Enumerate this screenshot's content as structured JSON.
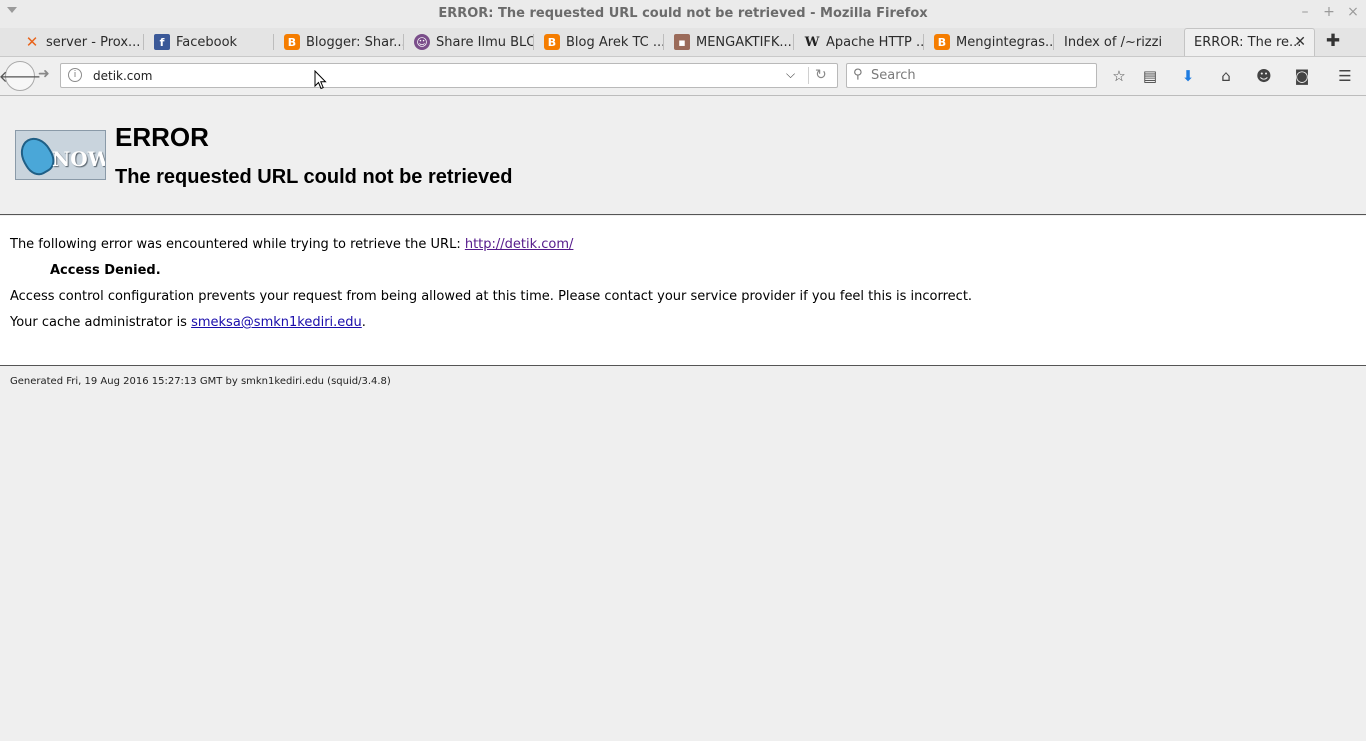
{
  "window": {
    "title": "ERROR: The requested URL could not be retrieved - Mozilla Firefox",
    "minimize": "–",
    "maximize": "+",
    "close": "×"
  },
  "tabs": [
    {
      "label": "server - Prox...",
      "icon": "x-mark-icon",
      "color": "#e8641b"
    },
    {
      "label": "Facebook",
      "icon": "facebook-icon",
      "color": "#3b5998"
    },
    {
      "label": "Blogger: Shar...",
      "icon": "blogger-icon",
      "color": "#f57d00"
    },
    {
      "label": "Share Ilmu BLC",
      "icon": "avatar-icon",
      "color": "#7a4e8a"
    },
    {
      "label": "Blog Arek TC ...",
      "icon": "blogger-icon",
      "color": "#f57d00"
    },
    {
      "label": "MENGAKTIFK...",
      "icon": "photo-icon",
      "color": "#9b6b5a"
    },
    {
      "label": "Apache HTTP ...",
      "icon": "wikipedia-icon",
      "color": "#333333"
    },
    {
      "label": "Mengintegras...",
      "icon": "blogger-icon",
      "color": "#f57d00"
    },
    {
      "label": "Index of /~rizzi",
      "icon": "",
      "color": ""
    },
    {
      "label": "ERROR: The re...",
      "icon": "",
      "color": "",
      "active": true
    }
  ],
  "navbar": {
    "url": "detik.com",
    "search_placeholder": "Search"
  },
  "page": {
    "logo_text": "NOW",
    "heading": "ERROR",
    "subheading": "The requested URL could not be retrieved",
    "intro": "The following error was encountered while trying to retrieve the URL: ",
    "error_url": "http://detik.com/",
    "access_denied": "Access Denied.",
    "description": "Access control configuration prevents your request from being allowed at this time. Please contact your service provider if you feel this is incorrect.",
    "admin_prefix": "Your cache administrator is ",
    "admin_email": "smeksa@smkn1kediri.edu",
    "admin_suffix": ".",
    "footer": "Generated Fri, 19 Aug 2016 15:27:13 GMT by smkn1kediri.edu (squid/3.4.8)"
  }
}
